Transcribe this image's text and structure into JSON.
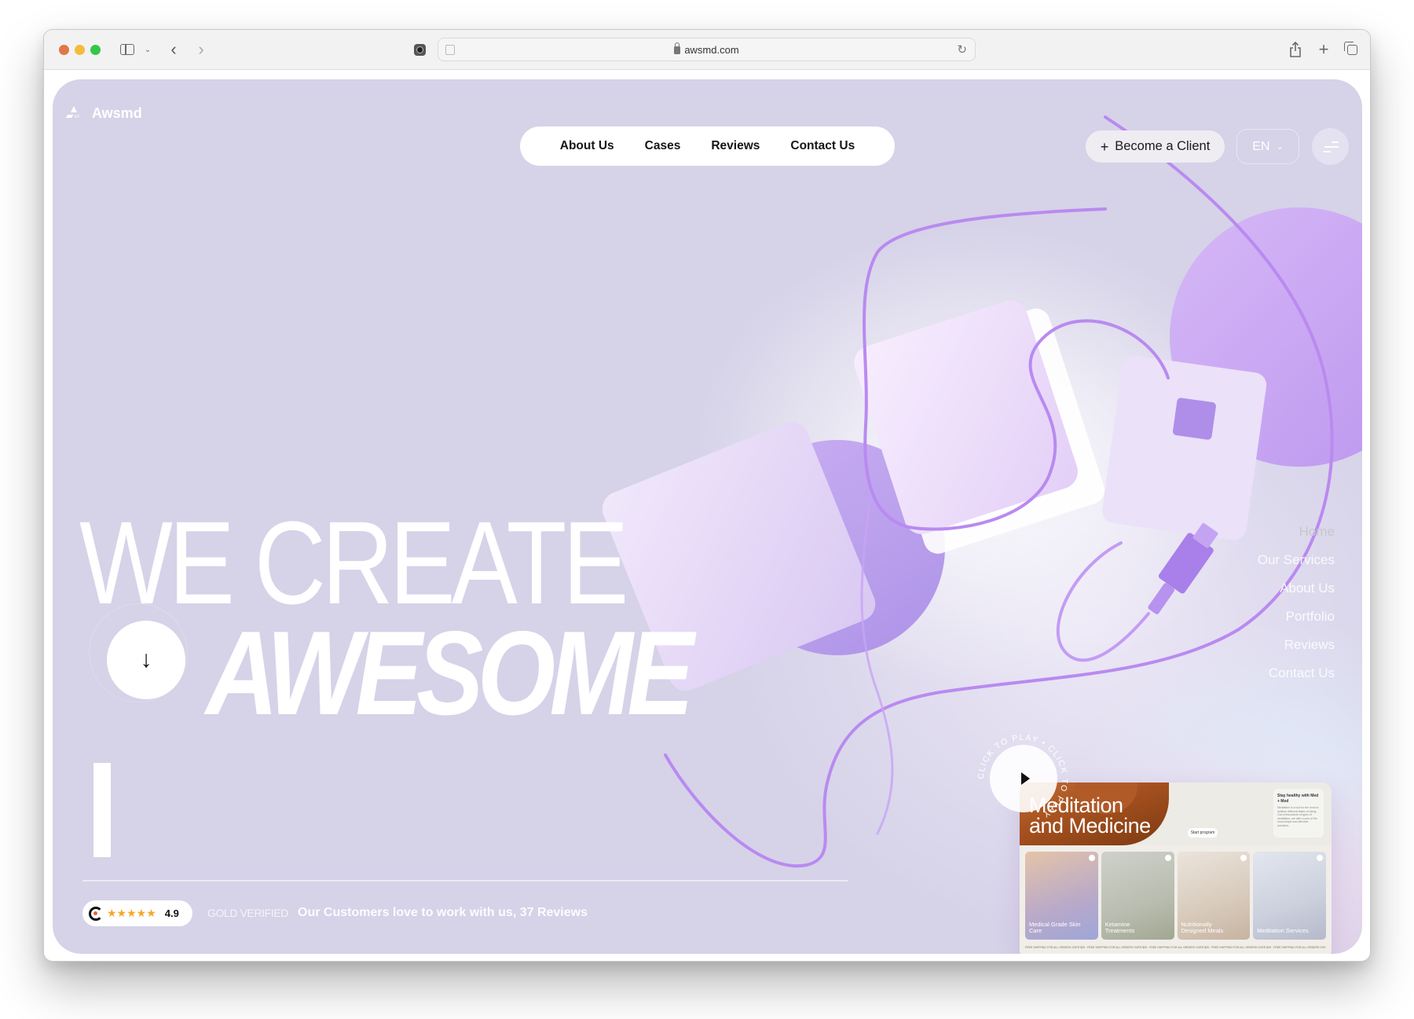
{
  "browser": {
    "url": "awsmd.com",
    "icons": {
      "sidebar": "sidebar-icon",
      "back": "chevron-left-icon",
      "forward": "chevron-right-icon",
      "share": "share-icon",
      "new_tab": "plus-icon",
      "tabs": "tabs-overview-icon",
      "reload": "reload-icon",
      "lock": "lock-icon"
    }
  },
  "header": {
    "logo": "Awsmd",
    "nav": [
      {
        "label": "About Us"
      },
      {
        "label": "Cases"
      },
      {
        "label": "Reviews"
      },
      {
        "label": "Contact Us"
      }
    ],
    "cta_label": "Become a Client",
    "cta_icon": "+",
    "language": "EN",
    "language_chevron": "⌄"
  },
  "hero": {
    "line1": "WE CREATE",
    "line2": "AWESOME",
    "scroll_icon": "↓"
  },
  "side_menu": [
    {
      "label": "Home",
      "active": true
    },
    {
      "label": "Our Services"
    },
    {
      "label": "About Us"
    },
    {
      "label": "Portfolio"
    },
    {
      "label": "Reviews"
    },
    {
      "label": "Contact Us"
    }
  ],
  "rating": {
    "stars": "★★★★★",
    "value": "4.9",
    "badge": "GOLD VERIFIED",
    "text": "Our Customers love to work with us, 37 Reviews"
  },
  "video": {
    "ring_text": "CLICK TO PLAY • CLICK TO PLAY • ",
    "preview": {
      "title_line1": "Meditation",
      "title_line2": "and Medicine",
      "start_button": "Start program",
      "info_title": "Stay healthy with Med + Med",
      "info_body": "Meditation is a tool for the mind to achieve different states of being. Out of thousands of types of meditation, we offer a core of the most simple and effective practices.",
      "tiles": [
        {
          "label": "Medical Grade Skin Care"
        },
        {
          "label": "Ketamine Treatments"
        },
        {
          "label": "Nutritionally Designed Meals"
        },
        {
          "label": "Meditation Services"
        }
      ],
      "ticker": "FREE SHIPPING FOR ALL ORDERS OVER $25 · FREE SHIPPING FOR ALL ORDERS OVER $25 · FREE SHIPPING FOR ALL ORDERS OVER $25 · FREE SHIPPING FOR ALL ORDERS OVER $25 · FREE SHIPPING FOR ALL ORDERS OVER $25"
    }
  },
  "colors": {
    "page_bg": "#d6d2e8",
    "accent_purple": "#b58cf0",
    "star": "#f6a727",
    "clutch_dot": "#e0653a"
  }
}
